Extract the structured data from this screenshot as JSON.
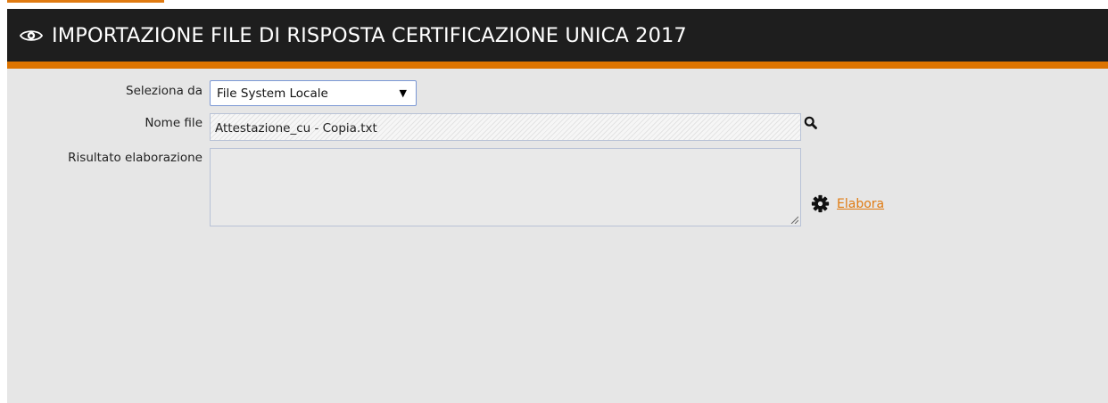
{
  "header": {
    "title": "IMPORTAZIONE FILE DI RISPOSTA CERTIFICAZIONE UNICA 2017",
    "icon": "eye-icon"
  },
  "form": {
    "source": {
      "label": "Seleziona da",
      "selected": "File System Locale"
    },
    "file": {
      "label": "Nome file",
      "value": "Attestazione_cu - Copia.txt",
      "icon": "search-icon"
    },
    "result": {
      "label": "Risultato elaborazione",
      "value": ""
    },
    "action": {
      "label": "Elabora",
      "icon": "gear-icon"
    }
  },
  "colors": {
    "accent": "#dd7400",
    "header_bg": "#1e1e1e",
    "content_bg": "#e6e6e6",
    "link": "#e07a10"
  }
}
